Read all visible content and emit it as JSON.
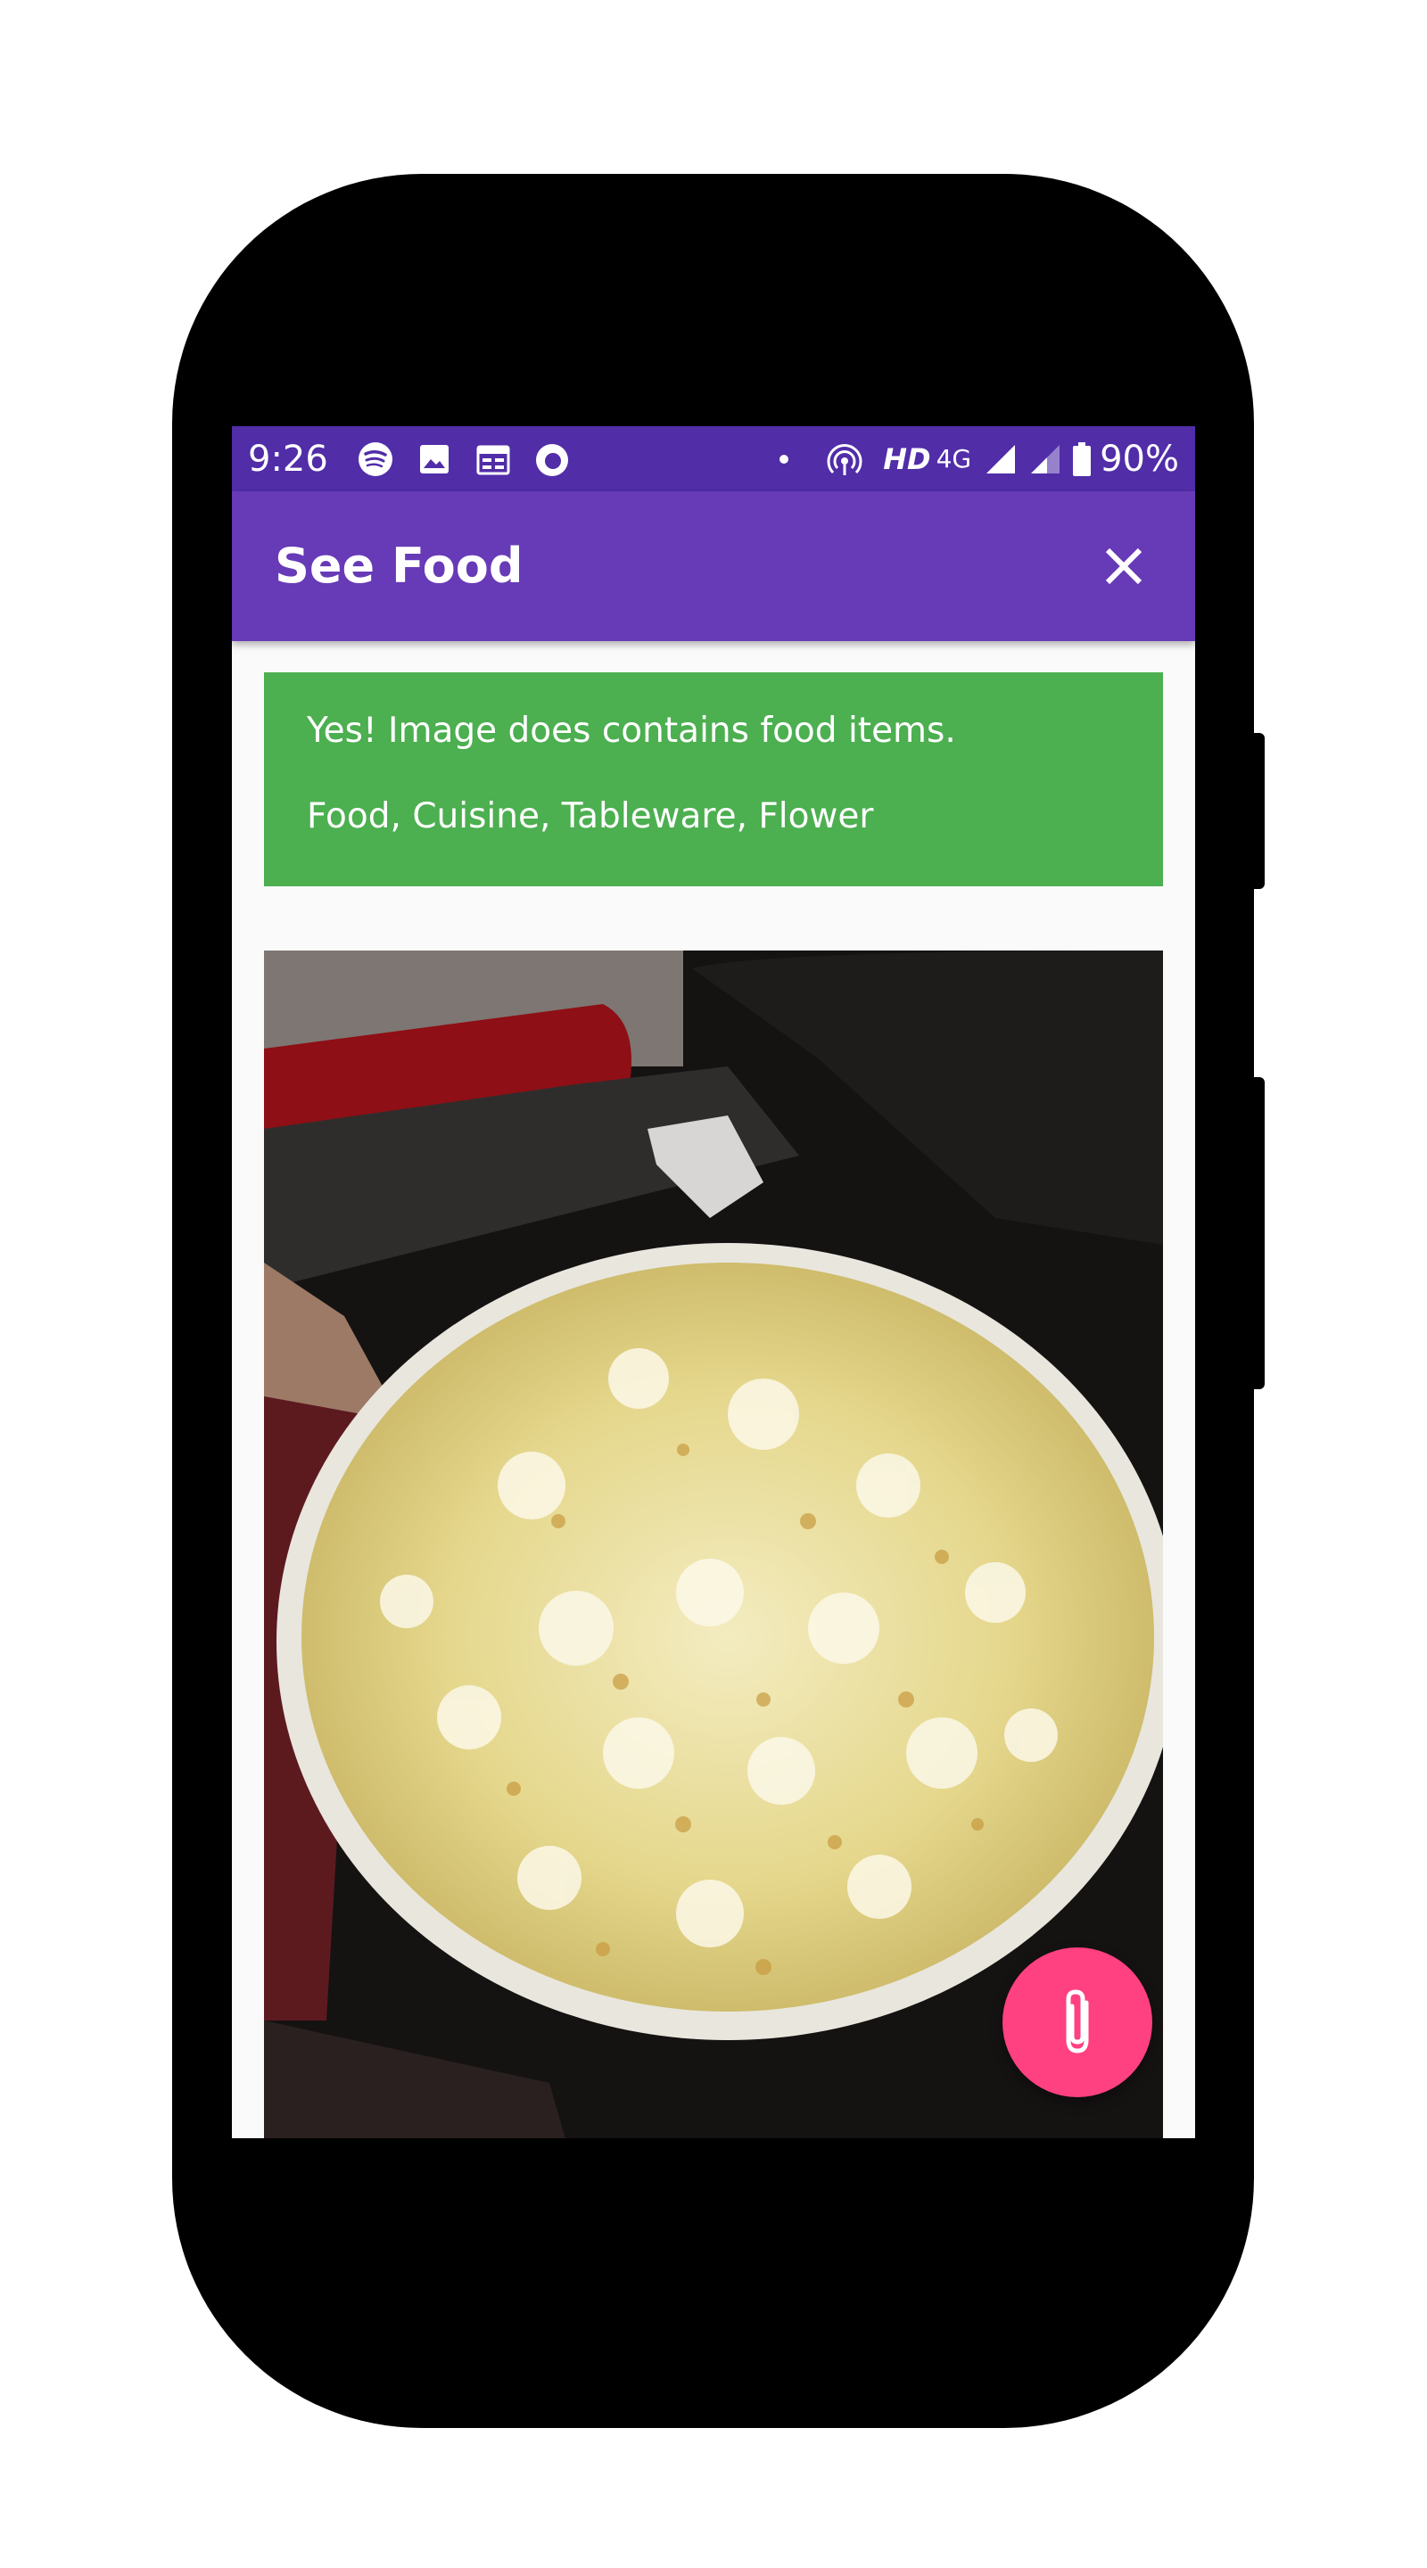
{
  "status_bar": {
    "time": "9:26",
    "network_hd": "HD",
    "network_type": "4G",
    "battery": "90%",
    "icons": [
      "spotify-icon",
      "image-icon",
      "calendar-icon",
      "firefox-icon",
      "hotspot-icon",
      "signal-icon",
      "signal-weak-icon",
      "battery-icon"
    ]
  },
  "app_bar": {
    "title": "See Food",
    "close_icon": "close-icon",
    "color": "#673ab7",
    "status_color": "#512da8"
  },
  "result": {
    "headline": "Yes! Image does contains food items.",
    "labels": "Food, Cuisine, Tableware, Flower",
    "color": "#4caf50"
  },
  "photo": {
    "subject": "bowl of popcorn"
  },
  "fab": {
    "icon": "attach-icon",
    "color": "#ff4081"
  }
}
